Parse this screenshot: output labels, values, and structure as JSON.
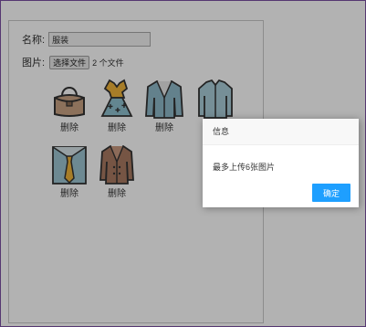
{
  "form": {
    "name_label": "名称:",
    "name_value": "服装",
    "image_label": "图片:",
    "choose_file_label": "选择文件",
    "file_status": "2 个文件"
  },
  "thumbnails": [
    {
      "icon": "handbag-icon",
      "delete_label": "删除"
    },
    {
      "icon": "dress-icon",
      "delete_label": "删除"
    },
    {
      "icon": "blazer-icon",
      "delete_label": "删除"
    },
    {
      "icon": "shirt-icon",
      "delete_label": ""
    },
    {
      "icon": "shirt-tie-icon",
      "delete_label": "删除"
    },
    {
      "icon": "trench-coat-icon",
      "delete_label": "删除"
    }
  ],
  "dialog": {
    "title": "信息",
    "message": "最多上传6张图片",
    "ok_label": "确定"
  },
  "colors": {
    "accent": "#1E9FFF",
    "frame_border": "#7a4fa3"
  }
}
